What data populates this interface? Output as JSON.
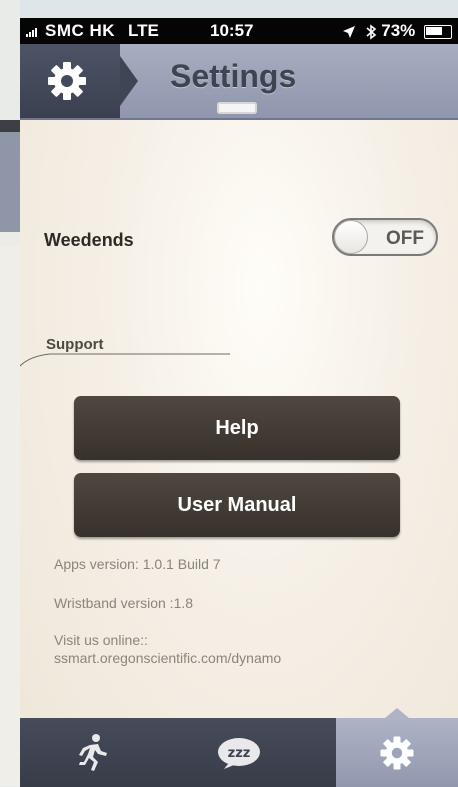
{
  "status_bar": {
    "carrier": "SMC HK",
    "network": "LTE",
    "time": "10:57",
    "battery": "73%",
    "icons": [
      "signal-icon",
      "location-icon",
      "bluetooth-icon",
      "battery-icon"
    ]
  },
  "header": {
    "title": "Settings",
    "left_icon": "gear-icon"
  },
  "settings": {
    "weekends_label": "Weedends",
    "weekends_toggle": "OFF",
    "support_label": "Support"
  },
  "buttons": {
    "help": "Help",
    "user_manual": "User Manual"
  },
  "info": {
    "apps_version": "Apps version: 1.0.1 Build 7",
    "wristband_version": "Wristband version :1.8",
    "visit_line1": "Visit us online::",
    "visit_line2": "ssmart.oregonscientific.com/dynamo"
  },
  "tab_bar": {
    "tabs": [
      {
        "icon": "runner-icon",
        "active": false
      },
      {
        "icon": "sleep-zzz-icon",
        "active": false
      },
      {
        "icon": "gear-icon",
        "active": true
      }
    ]
  },
  "colors": {
    "header_bg": "#9aa0b6",
    "button_bg": "#433b34",
    "tabbar_bg": "#3f4351",
    "active_tab_bg": "#a3a9bd"
  }
}
